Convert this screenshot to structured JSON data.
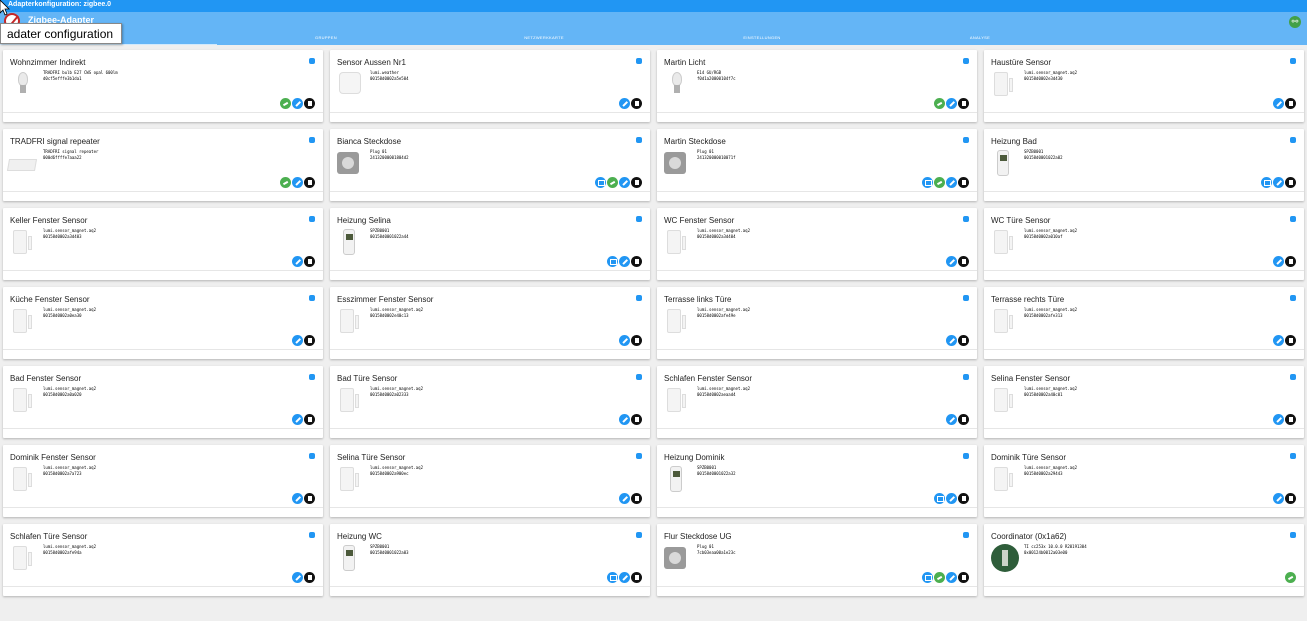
{
  "window": {
    "title": "Adapterkonfiguration: zigbee.0"
  },
  "header": {
    "title": "Zigbee-Adapter"
  },
  "tabs": [
    {
      "label": "GERÄTE"
    },
    {
      "label": "GRUPPEN"
    },
    {
      "label": "NETZWERKKARTE"
    },
    {
      "label": "EINSTELLUNGEN"
    },
    {
      "label": "ANALYSE"
    }
  ],
  "tooltip": {
    "text": "adater configuration"
  },
  "colors": {
    "accent": "#2196f3",
    "header": "#64b5f6",
    "link_green": "#4caf50",
    "danger": "#111111"
  },
  "devices": [
    {
      "name": "Wohnzimmer Indirekt",
      "line1": "TRADFRI bulb E27 CWS opal 600lm",
      "line2": "d0cf5efffe3b1da1",
      "type": "bulb",
      "actions": [
        "link",
        "edit",
        "delete"
      ]
    },
    {
      "name": "Sensor Aussen Nr1",
      "line1": "lumi.weather",
      "line2": "00158d0002a5e504",
      "type": "weather",
      "actions": [
        "edit",
        "delete"
      ]
    },
    {
      "name": "Martin Licht",
      "line1": "E14 GU/RGB",
      "line2": "f0d1a20000104f7c",
      "type": "bulb",
      "actions": [
        "link",
        "edit",
        "delete"
      ]
    },
    {
      "name": "Haustüre Sensor",
      "line1": "lumi.sensor_magnet.aq2",
      "line2": "00158d0002e3d430",
      "type": "sensor",
      "actions": [
        "edit",
        "delete"
      ]
    },
    {
      "name": "TRADFRI signal repeater",
      "line1": "TRADFRI signal repeater",
      "line2": "000d6ffffe7aaa22",
      "type": "repeater",
      "actions": [
        "link",
        "edit",
        "delete"
      ]
    },
    {
      "name": "Bianca Steckdose",
      "line1": "Plug 01",
      "line2": "24132000001804d2",
      "type": "plug",
      "actions": [
        "image",
        "link",
        "edit",
        "delete"
      ]
    },
    {
      "name": "Martin Steckdose",
      "line1": "Plug 01",
      "line2": "241320000010071f",
      "type": "plug",
      "actions": [
        "image",
        "link",
        "edit",
        "delete"
      ]
    },
    {
      "name": "Heizung Bad",
      "line1": "SPZB0001",
      "line2": "00158d0001022a02",
      "type": "valve",
      "actions": [
        "image",
        "edit",
        "delete"
      ]
    },
    {
      "name": "Keller Fenster Sensor",
      "line1": "lumi.sensor_magnet.aq2",
      "line2": "00158d0002a3d403",
      "type": "sensor",
      "actions": [
        "edit",
        "delete"
      ]
    },
    {
      "name": "Heizung Selina",
      "line1": "SPZB0001",
      "line2": "00158d0001022a44",
      "type": "valve",
      "actions": [
        "image",
        "edit",
        "delete"
      ]
    },
    {
      "name": "WC Fenster Sensor",
      "line1": "lumi.sensor_magnet.aq2",
      "line2": "00158d0002a3d404",
      "type": "sensor",
      "actions": [
        "edit",
        "delete"
      ]
    },
    {
      "name": "WC Türe Sensor",
      "line1": "lumi.sensor_magnet.aq2",
      "line2": "00158d0002a010af",
      "type": "sensor",
      "actions": [
        "edit",
        "delete"
      ]
    },
    {
      "name": "Küche Fenster Sensor",
      "line1": "lumi.sensor_magnet.aq2",
      "line2": "00158d0002a0ea30",
      "type": "sensor",
      "actions": [
        "edit",
        "delete"
      ]
    },
    {
      "name": "Esszimmer Fenster Sensor",
      "line1": "lumi.sensor_magnet.aq2",
      "line2": "00158d0002e40c13",
      "type": "sensor",
      "actions": [
        "edit",
        "delete"
      ]
    },
    {
      "name": "Terrasse links Türe",
      "line1": "lumi.sensor_magnet.aq2",
      "line2": "00158d0002afe49e",
      "type": "sensor",
      "actions": [
        "edit",
        "delete"
      ]
    },
    {
      "name": "Terrasse rechts Türe",
      "line1": "lumi.sensor_magnet.aq2",
      "line2": "00158d0002afe313",
      "type": "sensor",
      "actions": [
        "edit",
        "delete"
      ]
    },
    {
      "name": "Bad Fenster Sensor",
      "line1": "lumi.sensor_magnet.aq2",
      "line2": "00158d0002a0a020",
      "type": "sensor",
      "actions": [
        "edit",
        "delete"
      ]
    },
    {
      "name": "Bad Türe Sensor",
      "line1": "lumi.sensor_magnet.aq2",
      "line2": "00158d0002a02333",
      "type": "sensor",
      "actions": [
        "edit",
        "delete"
      ]
    },
    {
      "name": "Schlafen Fenster Sensor",
      "line1": "lumi.sensor_magnet.aq2",
      "line2": "00158d0002aeaad4",
      "type": "sensor",
      "actions": [
        "edit",
        "delete"
      ]
    },
    {
      "name": "Selina Fenster Sensor",
      "line1": "lumi.sensor_magnet.aq2",
      "line2": "00158d0002a40c01",
      "type": "sensor",
      "actions": [
        "edit",
        "delete"
      ]
    },
    {
      "name": "Dominik Fenster Sensor",
      "line1": "lumi.sensor_magnet.aq2",
      "line2": "00158d0002a7a723",
      "type": "sensor",
      "actions": [
        "edit",
        "delete"
      ]
    },
    {
      "name": "Selina Türe Sensor",
      "line1": "lumi.sensor_magnet.aq2",
      "line2": "00158d0002a900ec",
      "type": "sensor",
      "actions": [
        "edit",
        "delete"
      ]
    },
    {
      "name": "Heizung Dominik",
      "line1": "SPZB0001",
      "line2": "00158d0001022a32",
      "type": "valve",
      "actions": [
        "image",
        "edit",
        "delete"
      ]
    },
    {
      "name": "Dominik Türe Sensor",
      "line1": "lumi.sensor_magnet.aq2",
      "line2": "00158d0002a29443",
      "type": "sensor",
      "actions": [
        "edit",
        "delete"
      ]
    },
    {
      "name": "Schlafen Türe Sensor",
      "line1": "lumi.sensor_magnet.aq2",
      "line2": "00158d0002afe94a",
      "type": "sensor",
      "actions": [
        "edit",
        "delete"
      ]
    },
    {
      "name": "Heizung WC",
      "line1": "SPZB0001",
      "line2": "00158d0001022a03",
      "type": "valve",
      "actions": [
        "image",
        "edit",
        "delete"
      ]
    },
    {
      "name": "Flur Steckdose UG",
      "line1": "Plug 01",
      "line2": "7cb03eaa00a1e23c",
      "type": "plug",
      "actions": [
        "image",
        "link",
        "edit",
        "delete"
      ]
    },
    {
      "name": "Coordinator (0x1a62)",
      "line1": "TI cc253x 10.0.0 R20191304",
      "line2": "0x00124b0012a03e00",
      "type": "coord",
      "actions": [
        "link"
      ]
    }
  ]
}
